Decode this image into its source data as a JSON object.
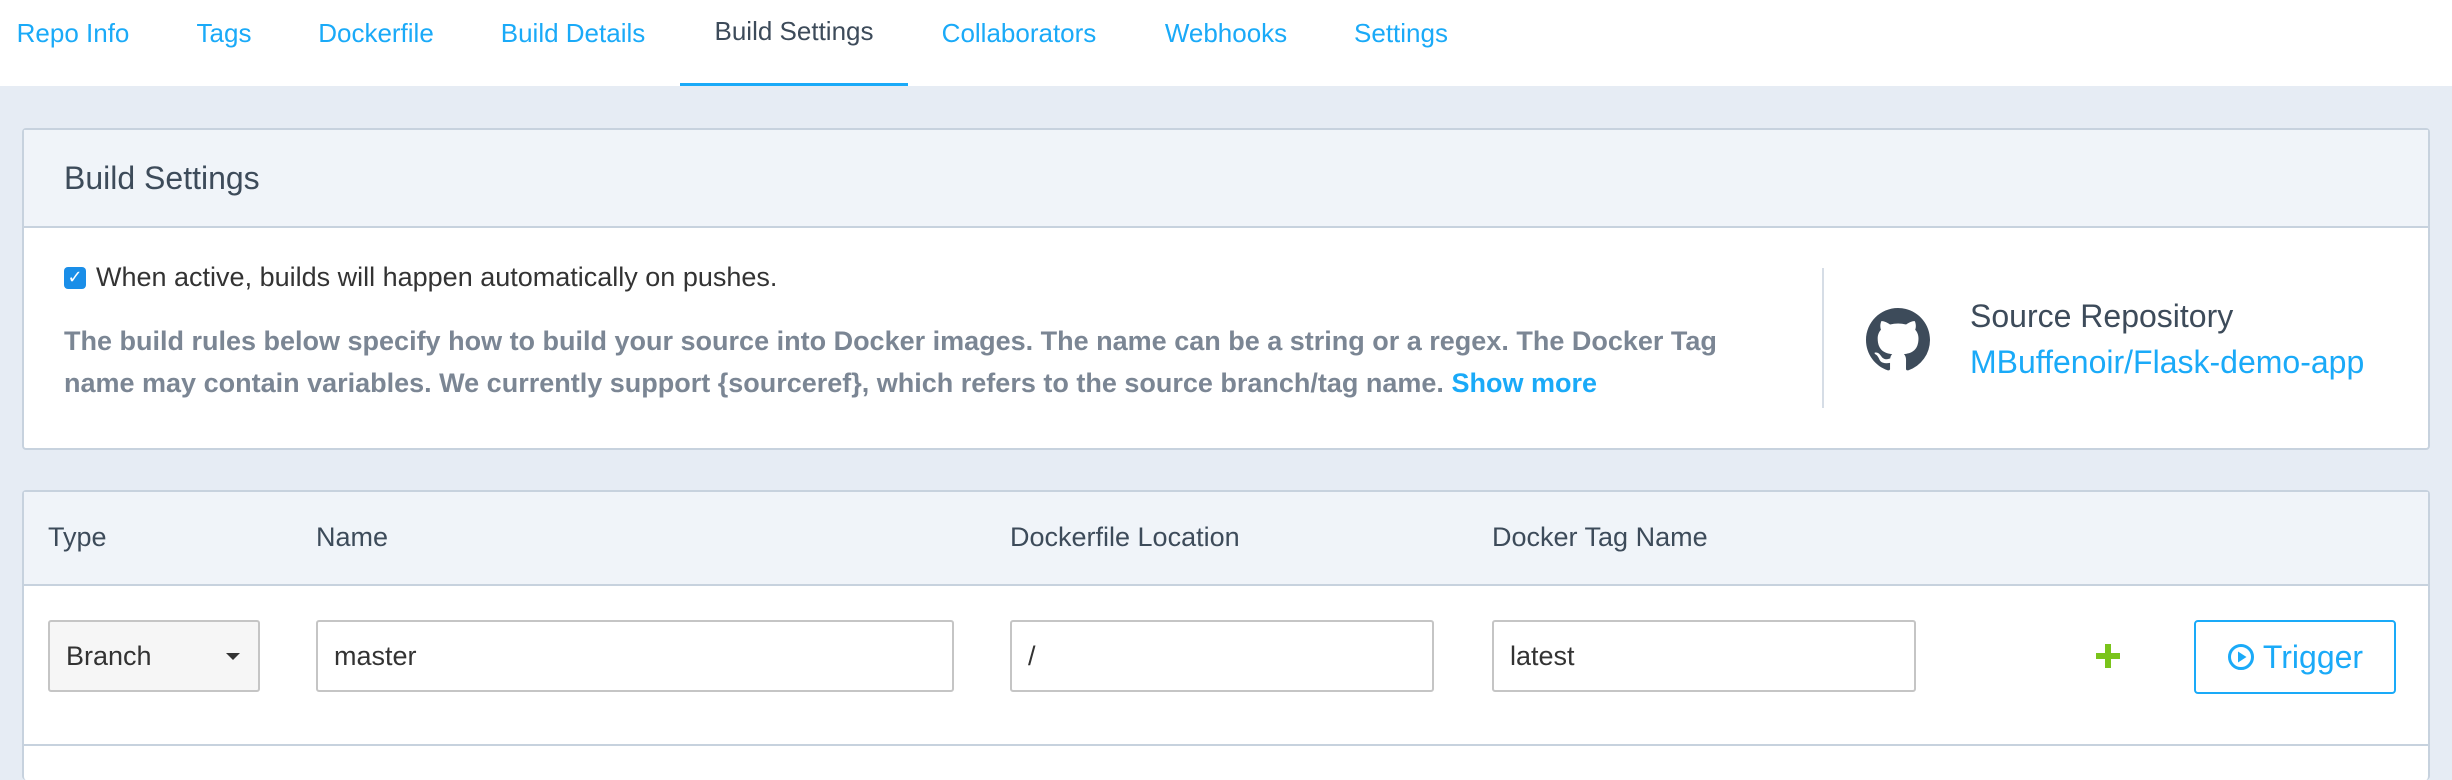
{
  "tabs": [
    {
      "label": "Repo Info"
    },
    {
      "label": "Tags"
    },
    {
      "label": "Dockerfile"
    },
    {
      "label": "Build Details"
    },
    {
      "label": "Build Settings",
      "active": true
    },
    {
      "label": "Collaborators"
    },
    {
      "label": "Webhooks"
    },
    {
      "label": "Settings"
    }
  ],
  "build_settings": {
    "title": "Build Settings",
    "auto_build_checked": true,
    "auto_build_text": "When active, builds will happen automatically on pushes.",
    "description": "The build rules below specify how to build your source into Docker images. The name can be a string or a regex. The Docker Tag name may contain variables. We currently support {sourceref}, which refers to the source branch/tag name.",
    "show_more": "Show more",
    "source_label": "Source Repository",
    "source_repo": "MBuffenoir/Flask-demo-app",
    "source_icon": "github-icon"
  },
  "rules_table": {
    "headers": {
      "type": "Type",
      "name": "Name",
      "dockerfile_location": "Dockerfile Location",
      "docker_tag_name": "Docker Tag Name"
    },
    "rows": [
      {
        "type": "Branch",
        "name": "master",
        "dockerfile_location": "/",
        "docker_tag_name": "latest",
        "add_icon": "plus-icon",
        "trigger_label": "Trigger",
        "trigger_icon": "play-circle-icon"
      }
    ]
  },
  "colors": {
    "accent": "#1aaaf8",
    "add_green": "#7ac41b",
    "checkbox_blue": "#1a8ee8"
  }
}
